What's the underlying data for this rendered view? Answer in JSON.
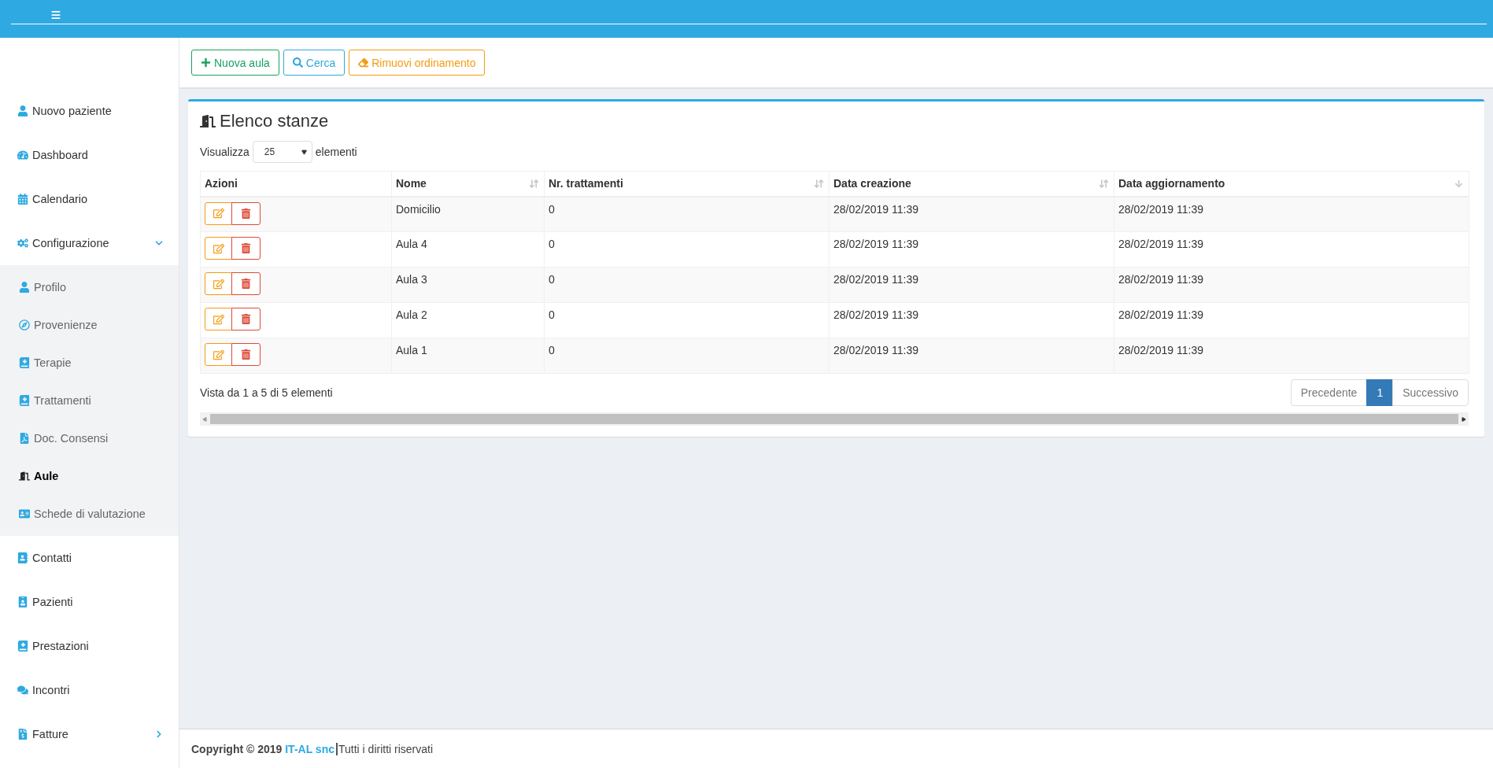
{
  "toolbar": {
    "buttons": [
      {
        "kind": "add",
        "label": "Nuova aula"
      },
      {
        "kind": "search",
        "label": "Cerca"
      },
      {
        "kind": "clear",
        "label": "Rimuovi ordinamento"
      }
    ]
  },
  "sidebar": {
    "items": [
      {
        "label": "Nuovo paziente",
        "selected": false
      },
      {
        "label": "Dashboard",
        "selected": false
      },
      {
        "label": "Calendario",
        "selected": false
      },
      {
        "label": "Configurazione",
        "selected": false,
        "expanded": true,
        "children": [
          {
            "label": "Profilo",
            "selected": false
          },
          {
            "label": "Provenienze",
            "selected": false
          },
          {
            "label": "Terapie",
            "selected": false
          },
          {
            "label": "Trattamenti",
            "selected": false
          },
          {
            "label": "Doc. Consensi",
            "selected": false
          },
          {
            "label": "Aule",
            "selected": true
          },
          {
            "label": "Schede di valutazione",
            "selected": false
          }
        ]
      },
      {
        "label": "Contatti",
        "selected": false
      },
      {
        "label": "Pazienti",
        "selected": false
      },
      {
        "label": "Prestazioni",
        "selected": false
      },
      {
        "label": "Incontri",
        "selected": false
      },
      {
        "label": "Fatture",
        "selected": false,
        "expanded": false
      }
    ]
  },
  "card": {
    "title": "Elenco stanze",
    "length_prefix": "Visualizza",
    "length_value": "25",
    "length_suffix": "elementi"
  },
  "table": {
    "columns": [
      {
        "label": "Azioni",
        "sortable": false
      },
      {
        "label": "Nome",
        "sortable": true
      },
      {
        "label": "Nr. trattamenti",
        "sortable": true
      },
      {
        "label": "Data creazione",
        "sortable": true
      },
      {
        "label": "Data aggiornamento",
        "sortable": true
      }
    ],
    "rows": [
      {
        "name": "Domicilio",
        "count": "0",
        "created": "28/02/2019 11:39",
        "updated": "28/02/2019 11:39"
      },
      {
        "name": "Aula 4",
        "count": "0",
        "created": "28/02/2019 11:39",
        "updated": "28/02/2019 11:39"
      },
      {
        "name": "Aula 3",
        "count": "0",
        "created": "28/02/2019 11:39",
        "updated": "28/02/2019 11:39"
      },
      {
        "name": "Aula 2",
        "count": "0",
        "created": "28/02/2019 11:39",
        "updated": "28/02/2019 11:39"
      },
      {
        "name": "Aula 1",
        "count": "0",
        "created": "28/02/2019 11:39",
        "updated": "28/02/2019 11:39"
      }
    ]
  },
  "info": "Vista da 1 a 5 di 5 elementi",
  "pagination": [
    {
      "label": "Precedente",
      "selected": false
    },
    {
      "label": "1",
      "selected": true
    },
    {
      "label": "Successivo",
      "selected": false
    }
  ],
  "footer": {
    "copyright": "Copyright © 2019",
    "company": "IT-AL snc",
    "rights": "Tutti i diritti riservati"
  }
}
